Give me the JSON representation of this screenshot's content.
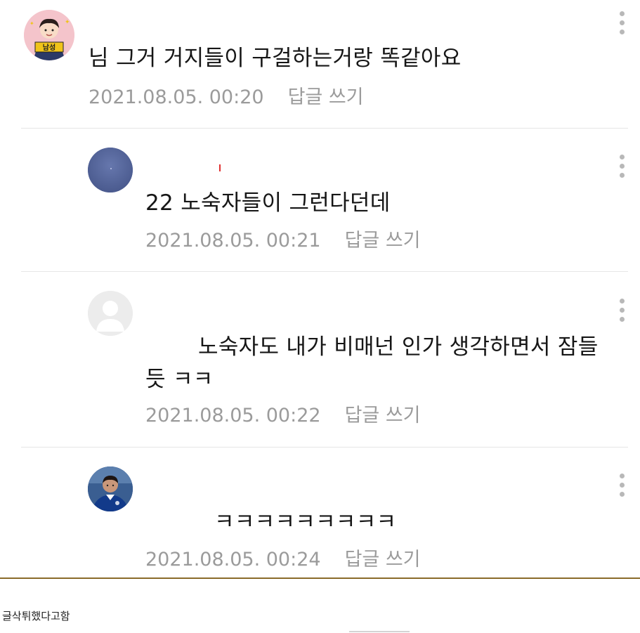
{
  "comments": [
    {
      "text": "님 그거 거지들이 구걸하는거랑 똑같아요",
      "date": "2021.08.05. 00:20",
      "reply": "답글 쓰기",
      "avatar_icon": "avatar-cartoon-man-holding-sign",
      "avatar_sign": "남성"
    },
    {
      "text": "22 노숙자들이 그런다던데",
      "date": "2021.08.05. 00:21",
      "reply": "답글 쓰기",
      "avatar_icon": "avatar-night-sky"
    },
    {
      "text_line1": "노숙자도 내가 비매넌 인가 생각하면서 잠들",
      "text_line2": "듯 ㅋㅋ",
      "date": "2021.08.05. 00:22",
      "reply": "답글 쓰기",
      "avatar_icon": "avatar-default-person"
    },
    {
      "text": "ㅋㅋㅋㅋㅋㅋㅋㅋㅋ",
      "date": "2021.08.05. 00:24",
      "reply": "답글 쓰기",
      "avatar_icon": "avatar-football-player-photo"
    }
  ],
  "caption": "글삭튀했다고함",
  "colors": {
    "meta_text": "#9b9b9b",
    "divider": "#e6e6e6",
    "bottom_rule": "#8a6b2a",
    "kebab": "#b8b8b8"
  }
}
